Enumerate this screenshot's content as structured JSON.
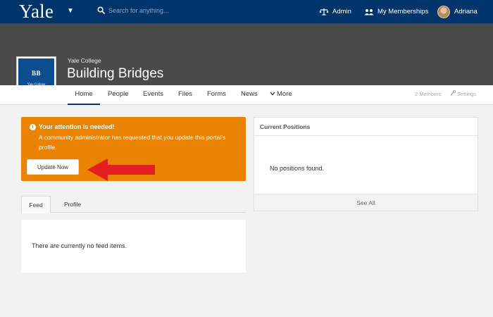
{
  "header": {
    "logo": "Yale",
    "search_placeholder": "Search for anything...",
    "admin_label": "Admin",
    "memberships_label": "My Memberships",
    "user_name": "Adriana"
  },
  "organization": {
    "parent": "Yale College",
    "name": "Building Bridges",
    "crest_initials": "BB",
    "crest_caption": "Yale College"
  },
  "tabs": [
    {
      "label": "Home",
      "active": true
    },
    {
      "label": "People"
    },
    {
      "label": "Events"
    },
    {
      "label": "Files"
    },
    {
      "label": "Forms"
    },
    {
      "label": "News"
    },
    {
      "label": "More"
    }
  ],
  "tab_meta": {
    "members": "2 Members",
    "settings": "Settings"
  },
  "alert": {
    "title": "Your attention is needed!",
    "message": "A community administrator has requested that you update this portal's profile.",
    "button": "Update Now",
    "color": "#e98301"
  },
  "feed_tabs": [
    "Feed",
    "Profile"
  ],
  "feed": {
    "empty_text": "There are currently no feed items."
  },
  "positions": {
    "title": "Current Positions",
    "empty_text": "No positions found.",
    "see_all": "See All"
  },
  "colors": {
    "navbar": "#00356b",
    "banner": "#4a4a4a",
    "alert": "#e98301",
    "arrow": "#e31e1e"
  }
}
